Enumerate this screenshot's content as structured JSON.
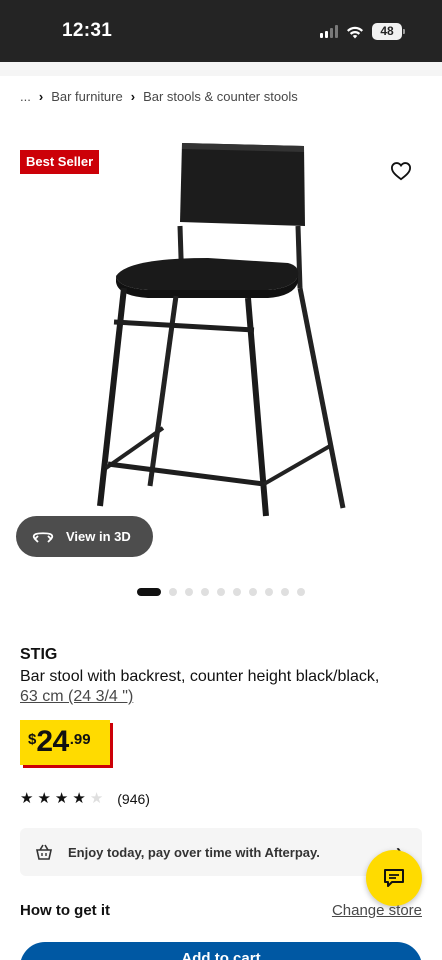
{
  "status_bar": {
    "time": "12:31",
    "battery": "48"
  },
  "breadcrumb": {
    "ellipsis": "...",
    "items": [
      "Bar furniture",
      "Bar stools & counter stools"
    ]
  },
  "product_image": {
    "badge": "Best Seller",
    "view_3d_label": "View in 3D",
    "gallery": {
      "total": 11,
      "current": 1
    }
  },
  "product": {
    "name": "STIG",
    "description": "Bar stool with backrest, counter height black/black,",
    "size": "63 cm (24 3/4 \")",
    "price": {
      "currency": "$",
      "integer": "24",
      "decimals": ".99"
    },
    "rating": {
      "stars": 4,
      "max": 5,
      "count": "(946)"
    }
  },
  "afterpay": {
    "text": "Enjoy today, pay over time with Afterpay."
  },
  "delivery": {
    "heading": "How to get it",
    "change_store": "Change store"
  },
  "cta": {
    "add_to_cart": "Add to cart"
  },
  "colors": {
    "status_bar_bg": "#242424",
    "badge_red": "#cc0008",
    "price_yellow": "#ffdb00",
    "primary_blue": "#0058a3"
  },
  "icons": [
    "cellular-signal-icon",
    "wifi-icon",
    "battery-icon",
    "heart-icon",
    "rotate-3d-icon",
    "star-icon",
    "afterpay-basket-icon",
    "chevron-right-icon",
    "chat-icon"
  ]
}
